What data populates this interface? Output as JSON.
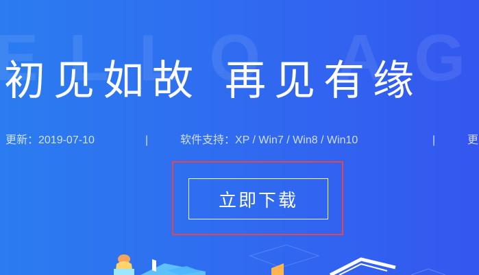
{
  "hero": {
    "watermark": "ELLO AGAIN",
    "title_part1": "初见如故",
    "title_part2": "再见有缘"
  },
  "meta": {
    "update": "更新：2019-07-10",
    "separator": "|",
    "support": "软件支持：XP / Win7 / Win8 / Win10",
    "more": "更"
  },
  "download": {
    "label": "立即下载"
  },
  "colors": {
    "background_left": "#2b7cf0",
    "background_right": "#3457ef",
    "highlight_border": "#e8454a"
  }
}
